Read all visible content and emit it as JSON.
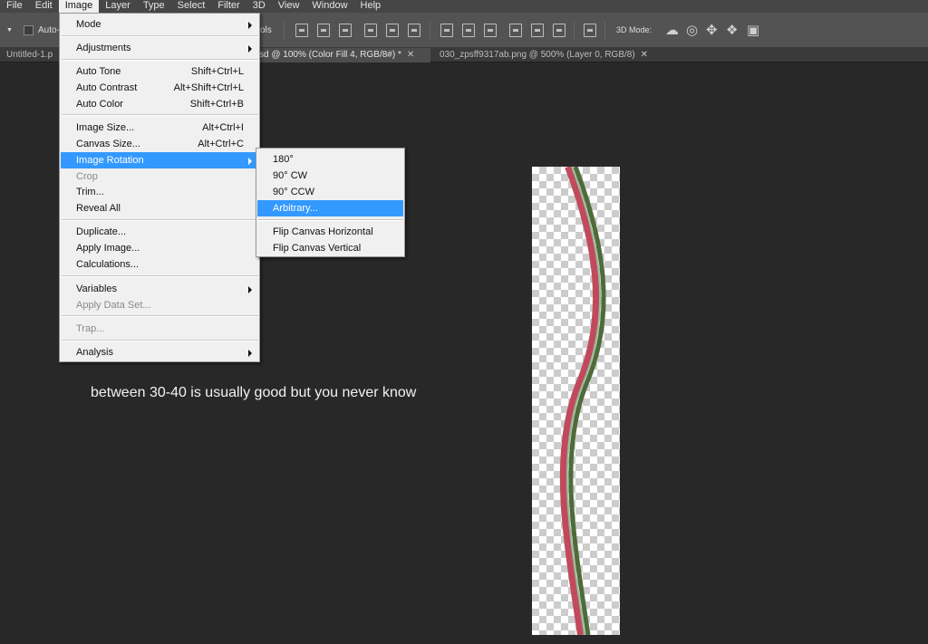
{
  "menubar": [
    "File",
    "Edit",
    "Image",
    "Layer",
    "Type",
    "Select",
    "Filter",
    "3D",
    "View",
    "Window",
    "Help"
  ],
  "options_bar": {
    "auto_select_label": "Auto-",
    "partial_label": "ols",
    "mode_3d_label": "3D Mode:"
  },
  "tabs": [
    {
      "label": "Untitled-1.p"
    },
    {
      "label": "sd @ 100% (Color Fill 4, RGB/8#) *"
    },
    {
      "label": "030_zpsff9317ab.png @ 500% (Layer 0, RGB/8)"
    }
  ],
  "image_menu": {
    "mode": "Mode",
    "adjustments": "Adjustments",
    "auto_tone": "Auto Tone",
    "auto_tone_sc": "Shift+Ctrl+L",
    "auto_contrast": "Auto Contrast",
    "auto_contrast_sc": "Alt+Shift+Ctrl+L",
    "auto_color": "Auto Color",
    "auto_color_sc": "Shift+Ctrl+B",
    "image_size": "Image Size...",
    "image_size_sc": "Alt+Ctrl+I",
    "canvas_size": "Canvas Size...",
    "canvas_size_sc": "Alt+Ctrl+C",
    "image_rotation": "Image Rotation",
    "crop": "Crop",
    "trim": "Trim...",
    "reveal_all": "Reveal All",
    "duplicate": "Duplicate...",
    "apply_image": "Apply Image...",
    "calculations": "Calculations...",
    "variables": "Variables",
    "apply_data_set": "Apply Data Set...",
    "trap": "Trap...",
    "analysis": "Analysis"
  },
  "rotation_submenu": {
    "r180": "180°",
    "cw90": "90° CW",
    "ccw90": "90° CCW",
    "arbitrary": "Arbitrary...",
    "flip_h": "Flip Canvas Horizontal",
    "flip_v": "Flip Canvas Vertical"
  },
  "canvas": {
    "caption": "between 30-40 is usually good but you never know",
    "stroke_colors": {
      "red": "#c04a5c",
      "green": "#4e6b3a",
      "light": "#9bb89a"
    }
  }
}
